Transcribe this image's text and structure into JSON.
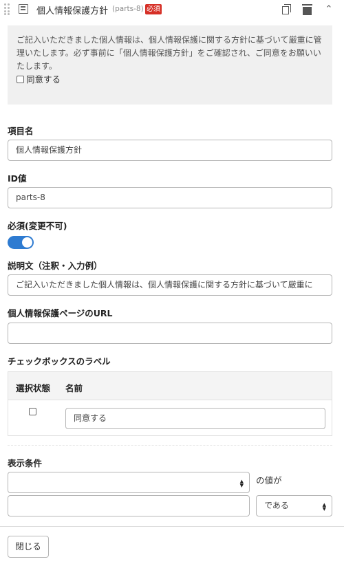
{
  "header": {
    "title": "個人情報保護方針",
    "tag": "(parts-8)",
    "required_badge": "必須",
    "icons": [
      "drag-handle-icon",
      "form-item-icon",
      "copy-icon",
      "trash-icon",
      "collapse-icon"
    ]
  },
  "preview": {
    "text": "ご記入いただきました個人情報は、個人情報保護に関する方針に基づいて厳重に管理いたします。必ず事前に「個人情報保護方針」をご確認され、ご同意をお願いいたします。",
    "checkbox_label": "同意する"
  },
  "fields": {
    "item_name": {
      "label": "項目名",
      "value": "個人情報保護方針"
    },
    "id_value": {
      "label": "ID値",
      "value": "parts-8"
    },
    "required": {
      "label": "必須(変更不可)",
      "on": true
    },
    "description": {
      "label": "説明文（注釈・入力例）",
      "value": "ご記入いただきました個人情報は、個人情報保護に関する方針に基づいて厳重に"
    },
    "privacy_url": {
      "label": "個人情報保護ページのURL",
      "value": ""
    }
  },
  "checkbox_labels": {
    "label": "チェックボックスのラベル",
    "columns": [
      "選択状態",
      "名前"
    ],
    "rows": [
      {
        "checked": false,
        "name": "同意する"
      }
    ]
  },
  "display_condition": {
    "label": "表示条件",
    "field_select": "",
    "of_value_text": "の値が",
    "value_input": "",
    "operator_select": "である"
  },
  "footer": {
    "close_label": "閉じる"
  },
  "colors": {
    "badge": "#d63027",
    "toggle": "#2e7bd1"
  }
}
